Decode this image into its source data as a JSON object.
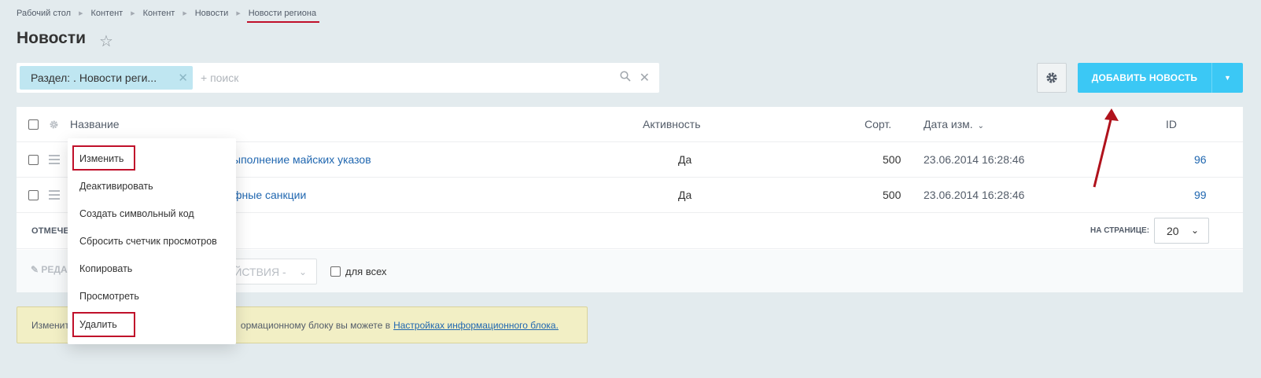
{
  "breadcrumb": [
    "Рабочий стол",
    "Контент",
    "Контент",
    "Новости",
    "Новости региона"
  ],
  "page": {
    "title": "Новости"
  },
  "filter": {
    "chip_label": "Раздел: . Новости реги...",
    "placeholder": "+ поиск"
  },
  "toolbar": {
    "add_label": "ДОБАВИТЬ НОВОСТЬ"
  },
  "grid": {
    "columns": {
      "name": "Название",
      "active": "Активность",
      "sort": "Сорт.",
      "date": "Дата изм.",
      "id": "ID"
    },
    "rows": [
      {
        "name": "ыполнение майских указов",
        "active": "Да",
        "sort": "500",
        "date": "23.06.2014 16:28:46",
        "id": "96"
      },
      {
        "name": "фные санкции",
        "active": "Да",
        "sort": "500",
        "date": "23.06.2014 16:28:46",
        "id": "99"
      }
    ],
    "marked_label": "ОТМЕЧЕН",
    "per_page_label": "НА СТРАНИЦЕ:",
    "per_page_value": "20",
    "edit_label": "РЕДА",
    "actions_label": "ЕЙСТВИЯ -",
    "for_all_label": "для всех"
  },
  "notice": {
    "text_start": "Изменит",
    "text_mid": "ормационному блоку вы можете в",
    "link": "Настройках информационного блока."
  },
  "context_menu": {
    "items": [
      "Изменить",
      "Деактивировать",
      "Создать символьный код",
      "Сбросить счетчик просмотров",
      "Копировать",
      "Просмотреть",
      "Удалить"
    ]
  },
  "colors": {
    "accent": "#3bc8f5",
    "highlight": "#c0102a",
    "link": "#2067b0",
    "background": "#e3ebee"
  }
}
